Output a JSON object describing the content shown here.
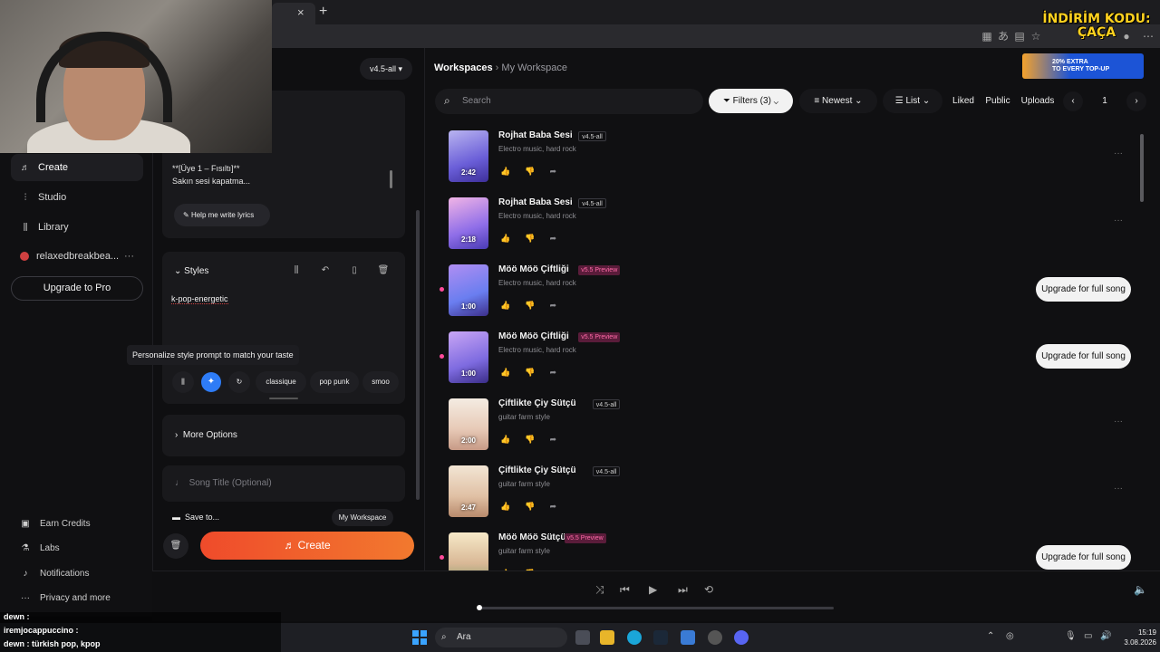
{
  "promo": {
    "line1": "İNDİRİM KODU:",
    "line2": "ÇAÇA"
  },
  "tab": {
    "close": "×",
    "new": "+"
  },
  "app": {
    "version": "v4.5-all",
    "nav": {
      "items": [
        {
          "label": "Create",
          "icon": "music-note-icon"
        },
        {
          "label": "Studio",
          "icon": "studio-icon"
        },
        {
          "label": "Library",
          "icon": "library-icon"
        },
        {
          "label": "relaxedbreakbea...",
          "icon": "avatar"
        }
      ],
      "more": "···",
      "upgrade": "Upgrade to Pro",
      "bottom": [
        {
          "label": "Earn Credits",
          "icon": "credits-icon"
        },
        {
          "label": "Labs",
          "icon": "labs-icon"
        },
        {
          "label": "Notifications",
          "icon": "bell-icon"
        },
        {
          "label": "Privacy and more",
          "icon": "more-icon"
        }
      ]
    },
    "lyrics": {
      "text": "**[Üye 1 – Fısıltı]**\nSakın sesi kapatma...",
      "help": "Help me write lyrics"
    },
    "styles": {
      "label": "Styles",
      "value": "k-pop-energetic",
      "tooltip": "Personalize style prompt to match your taste",
      "chips": [
        "classique",
        "pop punk",
        "smoo"
      ]
    },
    "more_options": "More Options",
    "song_title_placeholder": "Song Title (Optional)",
    "save_to": "Save to...",
    "workspace": "My Workspace",
    "create": "Create"
  },
  "workspace": {
    "breadcrumb": [
      "Workspaces",
      "My Workspace"
    ],
    "ad": {
      "line1": "20% EXTRA",
      "line2": "TO EVERY TOP-UP"
    },
    "search_placeholder": "Search",
    "filters": "Filters (3)",
    "sort": "Newest",
    "view": "List",
    "tabs": [
      "Liked",
      "Public",
      "Uploads"
    ],
    "page": "1",
    "songs": [
      {
        "title": "Rojhat Baba Sesi",
        "tag": "v4.5-all",
        "preview": false,
        "genre": "Electro music, hard rock",
        "duration": "2:42",
        "upgrade": false
      },
      {
        "title": "Rojhat Baba Sesi",
        "tag": "v4.5-all",
        "preview": false,
        "genre": "Electro music, hard rock",
        "duration": "2:18",
        "upgrade": false
      },
      {
        "title": "Möö Möö Çiftliği",
        "tag": "v5.5 Preview",
        "preview": true,
        "genre": "Electro music, hard rock",
        "duration": "1:00",
        "upgrade": true
      },
      {
        "title": "Möö Möö Çiftliği",
        "tag": "v5.5 Preview",
        "preview": true,
        "genre": "Electro music, hard rock",
        "duration": "1:00",
        "upgrade": true
      },
      {
        "title": "Çiftlikte Çiy Sütçü",
        "tag": "v4.5-all",
        "preview": false,
        "genre": "guitar farm style",
        "duration": "2:00",
        "upgrade": false
      },
      {
        "title": "Çiftlikte Çiy Sütçü",
        "tag": "v4.5-all",
        "preview": false,
        "genre": "guitar farm style",
        "duration": "2:47",
        "upgrade": false
      },
      {
        "title": "Möö Möö Sütçü",
        "tag": "v5.5 Preview",
        "preview": true,
        "genre": "guitar farm style",
        "duration": "",
        "upgrade": true
      }
    ],
    "upgrade_label": "Upgrade for full song"
  },
  "chat": [
    {
      "user": "dewn :",
      "msg": ""
    },
    {
      "user": "iremjocappuccino :",
      "msg": ""
    },
    {
      "user": "dewn :",
      "msg": "türkish pop, kpop"
    }
  ],
  "taskbar": {
    "search": "Ara",
    "time": "15:19",
    "date": "3.08.2026"
  },
  "colors": {
    "accent": "#ef4b2b",
    "preview": "#ff6aa8",
    "blue": "#2e7cf6"
  }
}
